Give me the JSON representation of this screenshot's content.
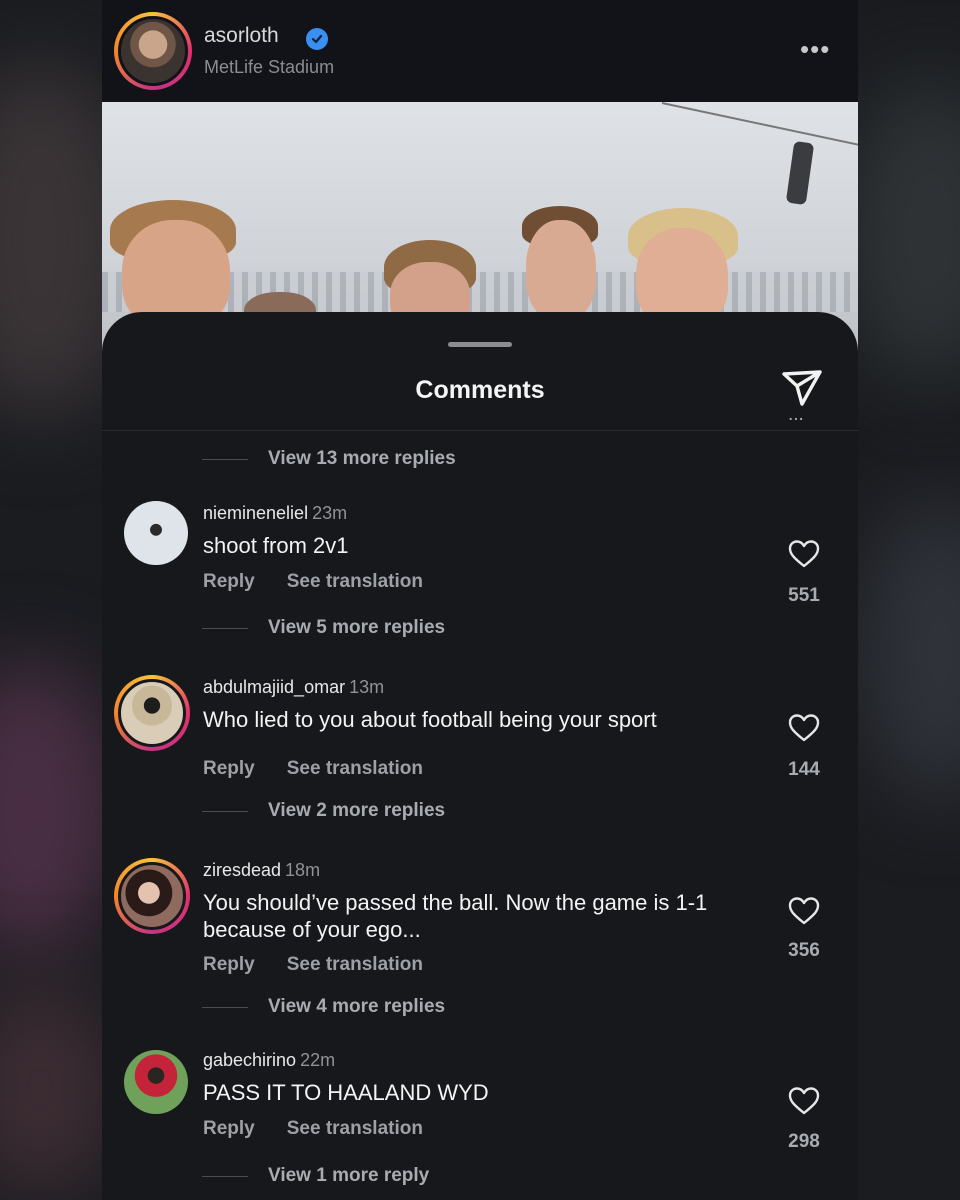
{
  "post": {
    "username": "asorloth",
    "location": "MetLife Stadium",
    "more_label": "•••"
  },
  "sheet": {
    "title": "Comments",
    "top_view_replies": "View 13 more replies"
  },
  "comments": [
    {
      "username": "niemineneliel",
      "time": "23m",
      "text": "shoot from 2v1",
      "reply_label": "Reply",
      "translate_label": "See translation",
      "likes": "551",
      "view_replies": "View 5 more replies"
    },
    {
      "username": "abdulmajiid_omar",
      "time": "13m",
      "text": "Who lied to you about football being your sport",
      "reply_label": "Reply",
      "translate_label": "See translation",
      "likes": "144",
      "view_replies": "View 2 more replies"
    },
    {
      "username": "ziresdead",
      "time": "18m",
      "text": "You should’ve passed the ball. Now the game is 1-1 because of your ego...",
      "reply_label": "Reply",
      "translate_label": "See translation",
      "likes": "356",
      "view_replies": "View 4 more replies"
    },
    {
      "username": "gabechirino",
      "time": "22m",
      "text": "PASS IT TO HAALAND WYD",
      "reply_label": "Reply",
      "translate_label": "See translation",
      "likes": "298",
      "view_replies": "View 1 more reply"
    }
  ],
  "colors": {
    "background": "#16181c",
    "verified": "#3a8ff0",
    "story_ring_start": "#f9c23c",
    "story_ring_end": "#c13584"
  },
  "icons": [
    "verified-badge-icon",
    "more-options-icon",
    "share-send-icon",
    "heart-icon"
  ]
}
